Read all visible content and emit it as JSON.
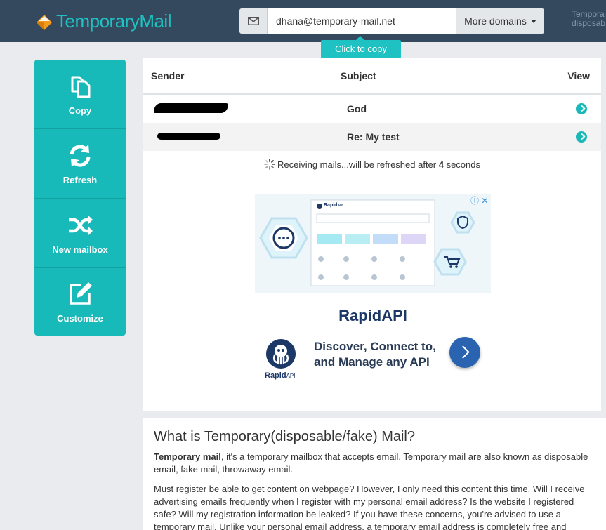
{
  "header": {
    "logo_text": "TemporaryMail",
    "email_value": "dhana@temporary-mail.net",
    "domains_label": "More domains",
    "right_text_line1": "Tempora",
    "right_text_line2": "disposab",
    "copy_tooltip": "Click to copy"
  },
  "sidebar": {
    "items": [
      {
        "label": "Copy",
        "icon": "copy-icon"
      },
      {
        "label": "Refresh",
        "icon": "refresh-icon"
      },
      {
        "label": "New mailbox",
        "icon": "shuffle-icon"
      },
      {
        "label": "Customize",
        "icon": "edit-icon"
      }
    ]
  },
  "inbox": {
    "columns": {
      "sender": "Sender",
      "subject": "Subject",
      "view": "View"
    },
    "rows": [
      {
        "sender": "",
        "subject": "God"
      },
      {
        "sender": "",
        "subject": "Re: My test"
      }
    ],
    "status_prefix": "Receiving mails...will be refreshed after ",
    "status_seconds": "4",
    "status_suffix": " seconds"
  },
  "ad": {
    "brand_mini": "Rapid",
    "brand_mini_suffix": "API",
    "title": "RapidAPI",
    "tagline_line1": "Discover, Connect to,",
    "tagline_line2": "and Manage any API",
    "logo_caption": "Rapid",
    "logo_caption_suffix": "API",
    "info_symbol": "ⓘ",
    "close_symbol": "✕"
  },
  "article": {
    "heading": "What is Temporary(disposable/fake) Mail?",
    "p1_bold": "Temporary mail",
    "p1_rest": ", it's a temporary mailbox that accepts email. Temporary mail are also known as disposable email, fake mail, throwaway email.",
    "p2": "Must register be able to get content on webpage? However, I only need this content this time. Will I receive advertising emails frequently when I register with my personal email address? Is the website I registered safe? Will my registration information be leaked? If you have these concerns, you're advised to use a temporary mail. Unlike your personal email address, a temporary email address is completely free and"
  },
  "colors": {
    "header_bg": "#34495e",
    "accent": "#18b9b9",
    "logo_orange": "#f59b1b"
  }
}
